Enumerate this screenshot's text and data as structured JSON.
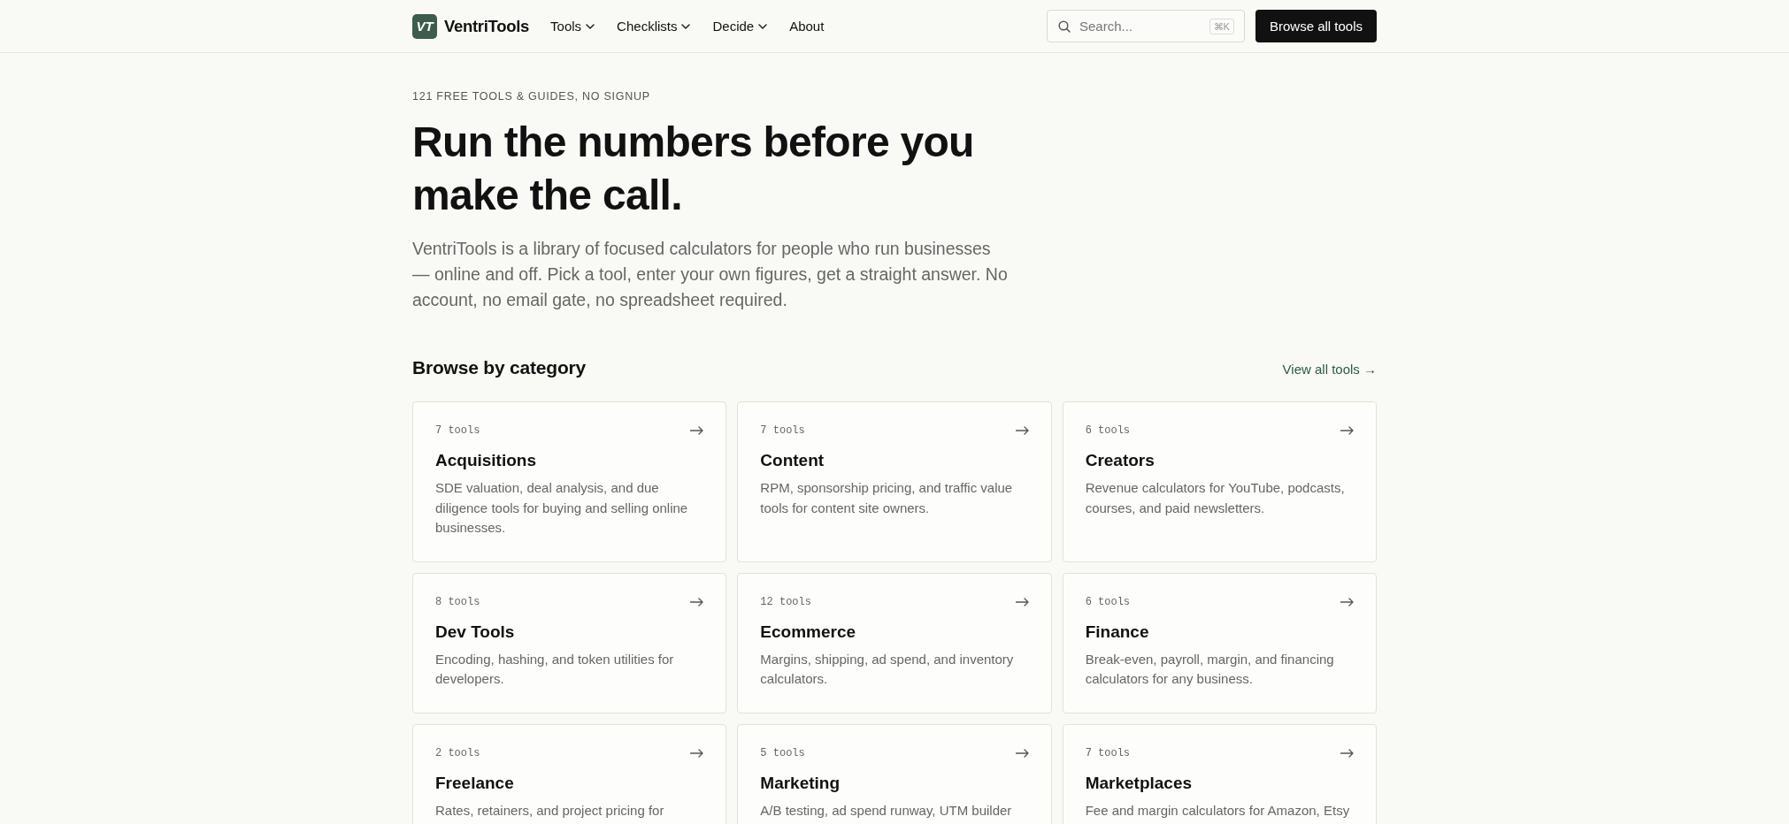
{
  "header": {
    "logo": {
      "mark": "VT",
      "name": "VentriTools"
    },
    "nav": [
      {
        "label": "Tools",
        "dropdown": true
      },
      {
        "label": "Checklists",
        "dropdown": true
      },
      {
        "label": "Decide",
        "dropdown": true
      },
      {
        "label": "About",
        "dropdown": false
      }
    ],
    "search": {
      "placeholder": "Search...",
      "shortcut": "⌘K"
    },
    "cta": "Browse all tools"
  },
  "hero": {
    "eyebrow": "121 FREE TOOLS & GUIDES, NO SIGNUP",
    "heading": "Run the numbers before you make the call.",
    "intro": "VentriTools is a library of focused calculators for people who run businesses — online and off. Pick a tool, enter your own figures, get a straight answer. No account, no email gate, no spreadsheet required."
  },
  "categories": {
    "title": "Browse by category",
    "view_all": "View all tools →",
    "cards": [
      {
        "count": "7 tools",
        "name": "Acquisitions",
        "description": "SDE valuation, deal analysis, and due diligence tools for buying and selling online businesses."
      },
      {
        "count": "7 tools",
        "name": "Content",
        "description": "RPM, sponsorship pricing, and traffic value tools for content site owners."
      },
      {
        "count": "6 tools",
        "name": "Creators",
        "description": "Revenue calculators for YouTube, podcasts, courses, and paid newsletters."
      },
      {
        "count": "8 tools",
        "name": "Dev Tools",
        "description": "Encoding, hashing, and token utilities for developers."
      },
      {
        "count": "12 tools",
        "name": "Ecommerce",
        "description": "Margins, shipping, ad spend, and inventory calculators."
      },
      {
        "count": "6 tools",
        "name": "Finance",
        "description": "Break-even, payroll, margin, and financing calculators for any business."
      },
      {
        "count": "2 tools",
        "name": "Freelance",
        "description": "Rates, retainers, and project pricing for"
      },
      {
        "count": "5 tools",
        "name": "Marketing",
        "description": "A/B testing, ad spend runway, UTM builder"
      },
      {
        "count": "7 tools",
        "name": "Marketplaces",
        "description": "Fee and margin calculators for Amazon, Etsy"
      }
    ]
  }
}
